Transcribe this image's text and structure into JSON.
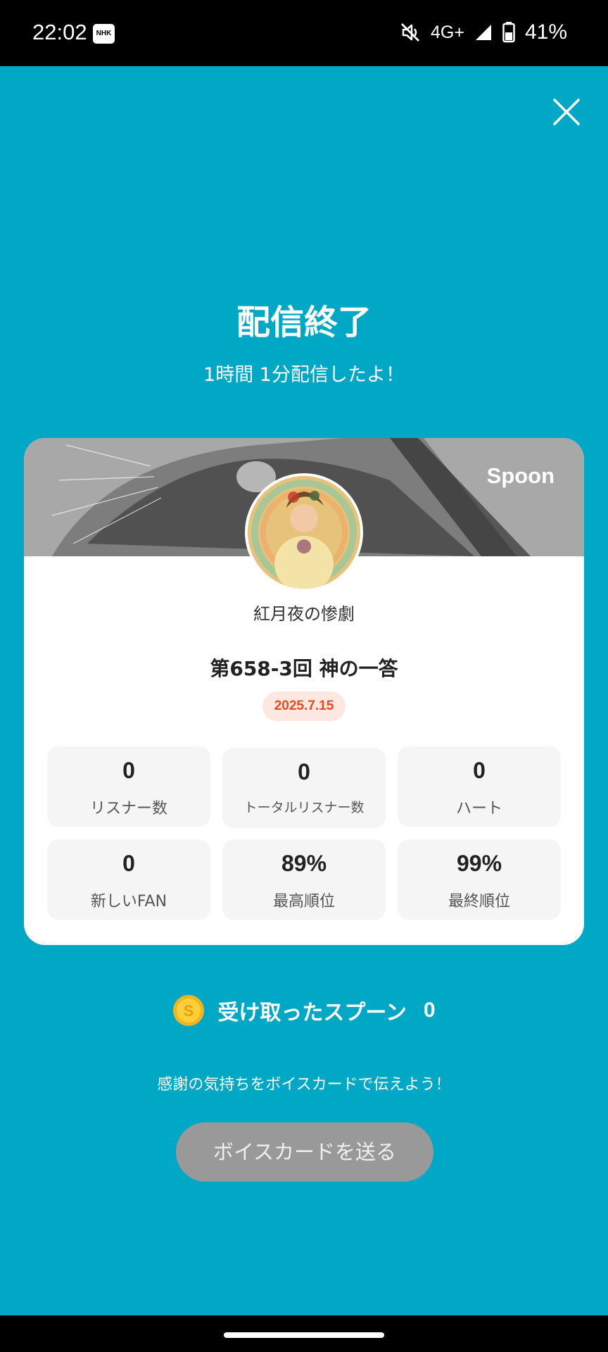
{
  "status_bar": {
    "time": "22:02",
    "notification_badge": "NHK",
    "network": "4G+",
    "battery": "41%",
    "icons": [
      "nhk-icon",
      "mute-icon",
      "signal-icon",
      "battery-icon"
    ]
  },
  "header": {
    "title": "配信終了",
    "subtitle": "1時間 1分配信したよ！"
  },
  "card": {
    "brand": "Spoon",
    "username": "紅月夜の惨劇",
    "live_title": "第658-3回 神の一答",
    "date": "2025.7.15",
    "stats": [
      {
        "value": "0",
        "label": "リスナー数"
      },
      {
        "value": "0",
        "label": "トータルリスナー数"
      },
      {
        "value": "0",
        "label": "ハート"
      },
      {
        "value": "0",
        "label": "新しいFAN"
      },
      {
        "value": "89%",
        "label": "最高順位"
      },
      {
        "value": "99%",
        "label": "最終順位"
      }
    ]
  },
  "spoons": {
    "label": "受け取ったスプーン",
    "count": "0",
    "coin_letter": "S"
  },
  "footer": {
    "thanks_text": "感謝の気持ちをボイスカードで伝えよう！",
    "voicecard_button": "ボイスカードを送る"
  },
  "colors": {
    "background": "#00a8c6",
    "date_badge_text": "#ec4a1c",
    "button_disabled": "#999999"
  }
}
